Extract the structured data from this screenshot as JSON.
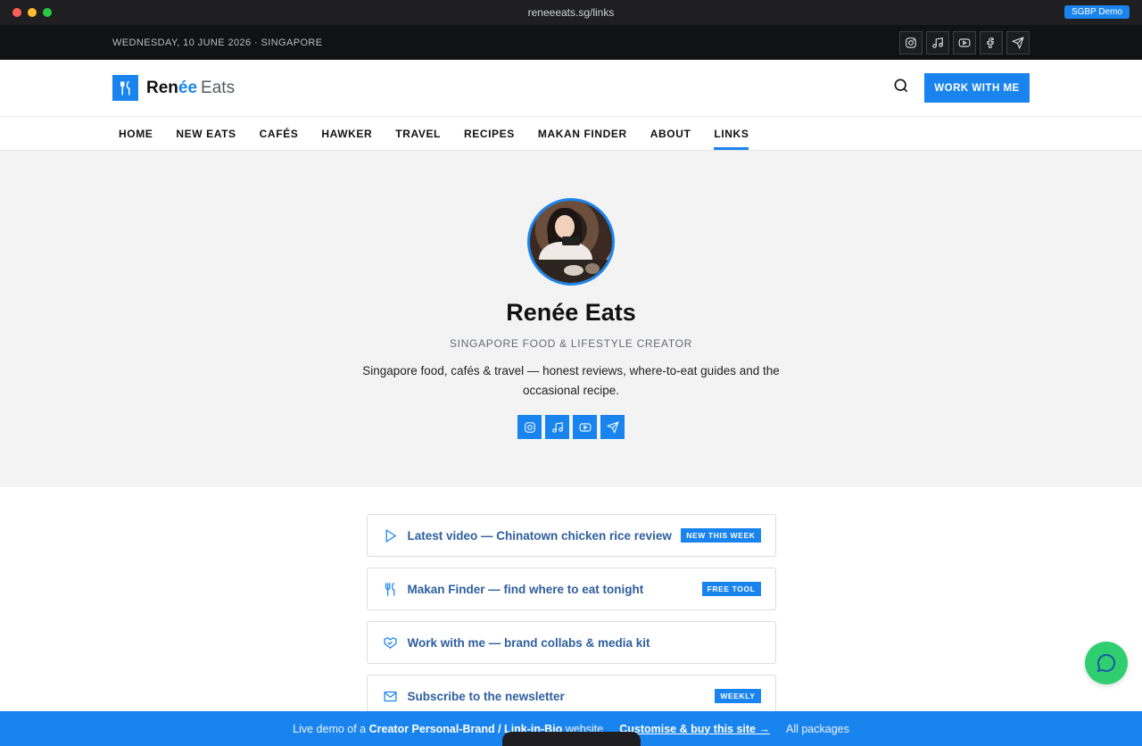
{
  "browser": {
    "url": "reneeeats.sg/links",
    "demo_badge": "SGBP Demo",
    "dot_colors": [
      "#ff5f57",
      "#febc2e",
      "#28c840"
    ]
  },
  "topbar": {
    "date": "WEDNESDAY, 10 JUNE 2026 · SINGAPORE",
    "social_icons": [
      "instagram-icon",
      "tiktok-icon",
      "youtube-icon",
      "facebook-icon",
      "telegram-icon"
    ]
  },
  "header": {
    "brand_part1": "Ren",
    "brand_accent": "ée",
    "brand_part2": "Eats",
    "cta_label": "WORK WITH ME"
  },
  "nav": {
    "items": [
      "HOME",
      "NEW EATS",
      "CAFÉS",
      "HAWKER",
      "TRAVEL",
      "RECIPES",
      "MAKAN FINDER",
      "ABOUT",
      "LINKS"
    ],
    "active": "LINKS"
  },
  "profile": {
    "name": "Renée Eats",
    "tagline": "SINGAPORE FOOD & LIFESTYLE CREATOR",
    "bio": "Singapore food, cafés & travel — honest reviews, where-to-eat guides and the occasional recipe.",
    "social_icons": [
      "instagram-icon",
      "tiktok-icon",
      "youtube-icon",
      "telegram-icon"
    ]
  },
  "links": [
    {
      "icon": "play-icon",
      "label": "Latest video — Chinatown chicken rice review",
      "badge": "NEW THIS WEEK"
    },
    {
      "icon": "utensils-icon",
      "label": "Makan Finder — find where to eat tonight",
      "badge": "FREE TOOL"
    },
    {
      "icon": "handshake-icon",
      "label": "Work with me — brand collabs & media kit",
      "badge": ""
    },
    {
      "icon": "mail-icon",
      "label": "Subscribe to the newsletter",
      "badge": "WEEKLY"
    }
  ],
  "promo": {
    "prefix": "Live demo of a",
    "bold": "Creator Personal-Brand / Link-in-Bio",
    "suffix": "website",
    "buy_label": "Customise & buy this site →",
    "packages_label": "All packages"
  },
  "colors": {
    "accent": "#1a84ee",
    "chat": "#2fcf6f",
    "topbar": "#111215"
  }
}
